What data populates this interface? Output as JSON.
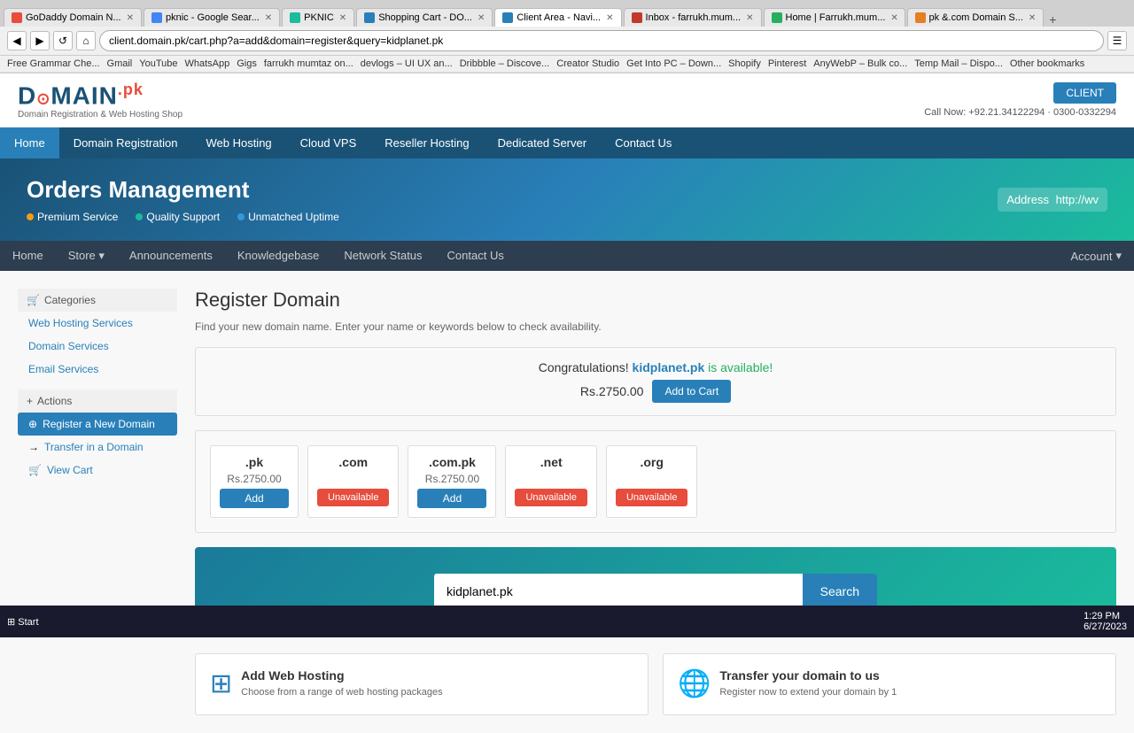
{
  "browser": {
    "address": "client.domain.pk/cart.php?a=add&domain=register&query=kidplanet.pk",
    "tabs": [
      {
        "label": "GoDaddy Domain N...",
        "active": false
      },
      {
        "label": "pknic - Google Sear...",
        "active": false
      },
      {
        "label": "PKNIC",
        "active": false
      },
      {
        "label": "Shopping Cart - DO...",
        "active": false
      },
      {
        "label": "Client Area - Navi...",
        "active": true
      },
      {
        "label": "Inbox - farrukh.mum...",
        "active": false
      },
      {
        "label": "Home | Farrukh.mum...",
        "active": false
      },
      {
        "label": "pk &.com Domain S...",
        "active": false
      }
    ],
    "bookmarks": [
      "Free Grammar Che...",
      "Gmail",
      "YouTube",
      "WhatsApp",
      "Gigs",
      "farrukh mumtaz on...",
      "devlogs – UI UX an...",
      "Dribbble – Discove...",
      "Creator Studio",
      "Get Into PC – Down...",
      "Shopify",
      "Pinterest",
      "AnyWebP – Bulk co...",
      "Temp Mail – Dispo...",
      "Other bookmarks"
    ]
  },
  "site": {
    "logo_main": "D⊙MAIN",
    "logo_pk": ".pk",
    "logo_sub": "Domain Registration & Web Hosting Shop",
    "phone": "Call Now: +92.21.34122294 · 0300-0332294",
    "client_btn": "CLIENT",
    "main_nav": [
      {
        "label": "Home",
        "active": true
      },
      {
        "label": "Domain Registration"
      },
      {
        "label": "Web Hosting"
      },
      {
        "label": "Cloud VPS"
      },
      {
        "label": "Reseller Hosting"
      },
      {
        "label": "Dedicated Server"
      },
      {
        "label": "Contact Us"
      }
    ],
    "banner": {
      "title": "Orders Management",
      "features": [
        {
          "label": "Premium Service",
          "dot_class": "dot-orange"
        },
        {
          "label": "Quality Support",
          "dot_class": "dot-teal"
        },
        {
          "label": "Unmatched Uptime",
          "dot_class": "dot-blue"
        }
      ],
      "address_label": "Address",
      "address_value": "http://wv"
    },
    "secondary_nav": [
      {
        "label": "Home"
      },
      {
        "label": "Store",
        "has_arrow": true
      },
      {
        "label": "Announcements"
      },
      {
        "label": "Knowledgebase"
      },
      {
        "label": "Network Status"
      },
      {
        "label": "Contact Us"
      }
    ],
    "account_label": "Account"
  },
  "sidebar": {
    "categories_label": "Categories",
    "categories": [
      {
        "label": "Web Hosting Services"
      },
      {
        "label": "Domain Services"
      },
      {
        "label": "Email Services"
      }
    ],
    "actions_label": "Actions",
    "actions": [
      {
        "label": "Register a New Domain",
        "active": true
      },
      {
        "label": "Transfer in a Domain"
      },
      {
        "label": "View Cart"
      }
    ]
  },
  "main": {
    "page_title": "Register Domain",
    "page_desc": "Find your new domain name. Enter your name or keywords below to check availability.",
    "available_msg_prefix": "Congratulations!",
    "available_domain": "kidplanet.pk",
    "available_msg_suffix": "is available!",
    "price": "Rs.2750.00",
    "add_cart_btn": "Add to Cart",
    "domain_options": [
      {
        "ext": ".pk",
        "price": "Rs.2750.00",
        "status": "available",
        "btn_label": "Add"
      },
      {
        "ext": ".com",
        "price": "",
        "status": "unavailable",
        "btn_label": "Unavailable"
      },
      {
        "ext": ".com.pk",
        "price": "Rs.2750.00",
        "status": "available",
        "btn_label": "Add"
      },
      {
        "ext": ".net",
        "price": "",
        "status": "unavailable",
        "btn_label": "Unavailable"
      },
      {
        "ext": ".org",
        "price": "",
        "status": "unavailable",
        "btn_label": "Unavailable"
      }
    ],
    "search_input_value": "kidplanet.pk",
    "search_btn": "Search",
    "bottom_cards": [
      {
        "title": "Add Web Hosting",
        "desc": "Choose from a range of web hosting packages",
        "icon": "⊞"
      },
      {
        "title": "Transfer your domain to us",
        "desc": "Register now to extend your domain by 1",
        "icon": "🌐"
      }
    ]
  },
  "taskbar": {
    "clock": "1:29 PM\n6/27/2023"
  }
}
